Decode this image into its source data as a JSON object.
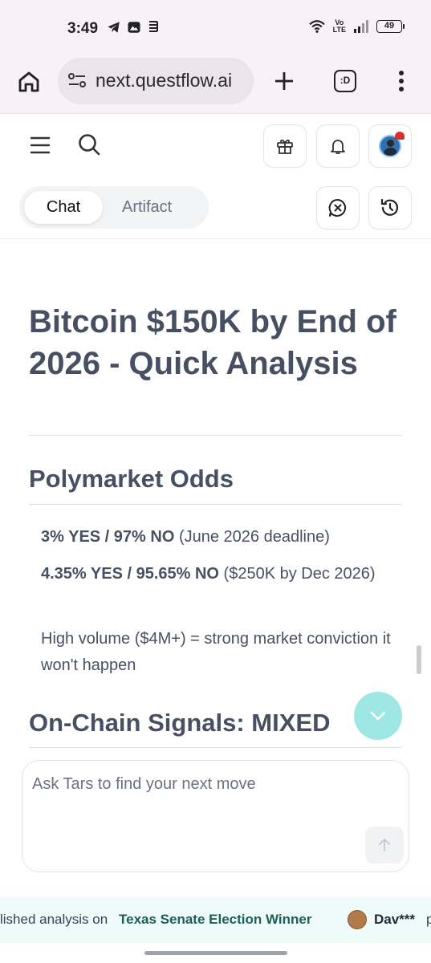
{
  "status_bar": {
    "time": "3:49",
    "network_label": "Vo\nLTE",
    "battery": "49",
    "left_icons": [
      "telegram-icon",
      "gallery-icon",
      "hologram-icon"
    ],
    "right_icons": [
      "wifi-icon",
      "volte-icon",
      "signal-icon",
      "battery-icon"
    ]
  },
  "browser": {
    "url": "next.questflow.ai",
    "tabs_label": ":D"
  },
  "tabs": {
    "chat_label": "Chat",
    "artifact_label": "Artifact",
    "active": "Chat"
  },
  "article": {
    "title": "Bitcoin $150K by End of 2026 - Quick Analysis",
    "section1": "Polymarket Odds",
    "odds1_bold": "3% YES / 97% NO",
    "odds1_rest": " (June 2026 deadline)",
    "odds2_bold": "4.35% YES / 95.65% NO",
    "odds2_rest": " ($250K by Dec 2026)",
    "volume_note": "High volume ($4M+) = strong market conviction it won't happen",
    "section2": "On-Chain Signals: MIXED"
  },
  "composer": {
    "placeholder": "Ask Tars to find your next move"
  },
  "ticker": {
    "text": "lished analysis on",
    "topic": "Texas Senate Election Winner",
    "user": "Dav***",
    "more": "p"
  },
  "colors": {
    "heading": "#475062",
    "fab": "#9fe7e4",
    "ticker_bg": "#eefbf9",
    "browser_bg": "#f8f1f8"
  }
}
